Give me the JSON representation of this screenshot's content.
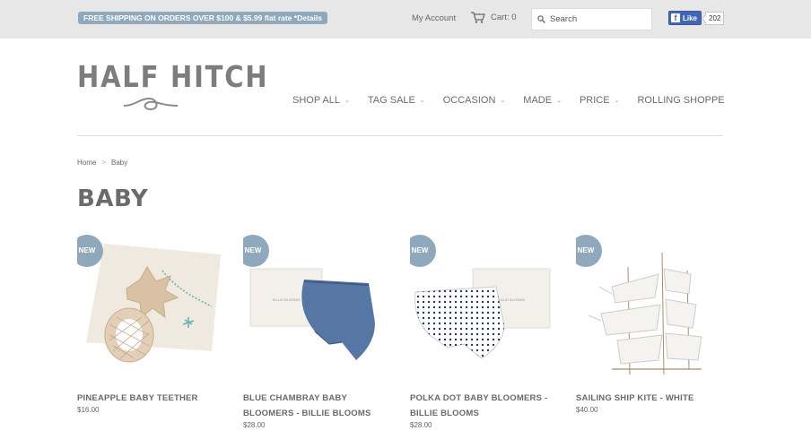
{
  "topbar": {
    "promo": "FREE SHIPPING ON ORDERS OVER $100 & $5.99 flat rate *Details",
    "account": "My Account",
    "cart": "Cart: 0",
    "search_placeholder": "Search",
    "fb_like": "Like",
    "fb_count": "202"
  },
  "header": {
    "logo": "HALF HITCH",
    "nav": [
      "SHOP ALL",
      "TAG SALE",
      "OCCASION",
      "MADE",
      "PRICE",
      "ROLLING SHOPPE"
    ]
  },
  "breadcrumb": {
    "home": "Home",
    "sep": ">",
    "current": "Baby"
  },
  "page_title": "BABY",
  "products": [
    {
      "badge": "NEW",
      "name": "PINEAPPLE BABY TEETHER",
      "price": "$16.00"
    },
    {
      "badge": "NEW",
      "name": "BLUE CHAMBRAY BABY BLOOMERS - BILLIE BLOOMS",
      "price": "$28.00"
    },
    {
      "badge": "NEW",
      "name": "POLKA DOT BABY BLOOMERS - BILLIE BLOOMS",
      "price": "$28.00"
    },
    {
      "badge": "NEW",
      "name": "SAILING SHIP KITE - WHITE",
      "price": "$40.00"
    }
  ],
  "colors": {
    "accent": "#8fa8bb",
    "topbar_bg": "#e7e7e7",
    "fb_blue": "#4267b2"
  },
  "icons": [
    "cart-icon",
    "search-icon",
    "facebook-icon",
    "chevron-down-icon"
  ]
}
